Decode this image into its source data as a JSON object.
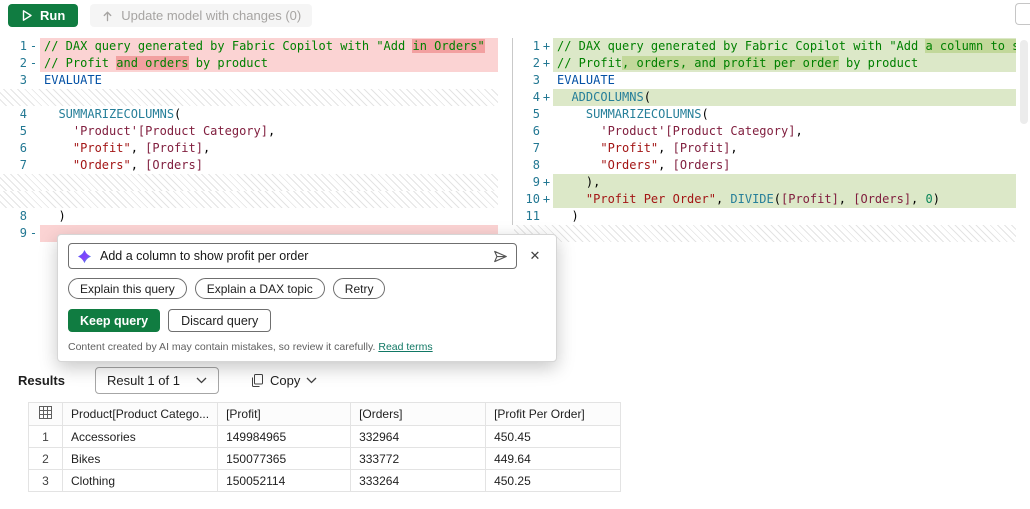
{
  "toolbar": {
    "run_label": "Run",
    "update_model_label": "Update model with changes (0)"
  },
  "editor": {
    "left": {
      "rows": [
        {
          "num": "1",
          "marker": "-",
          "kind": "del",
          "segments": [
            {
              "t": "// DAX query generated by Fabric Copilot with \"Add ",
              "c": "comment"
            },
            {
              "t": "in Orders\"",
              "c": "comment",
              "hl": true
            }
          ]
        },
        {
          "num": "2",
          "marker": "-",
          "kind": "del",
          "segments": [
            {
              "t": "// Profit ",
              "c": "comment"
            },
            {
              "t": "and orders",
              "c": "comment",
              "hl": true
            },
            {
              "t": " by product",
              "c": "comment"
            }
          ]
        },
        {
          "num": "3",
          "marker": "",
          "kind": "same",
          "segments": [
            {
              "t": "EVALUATE",
              "c": "keyword"
            }
          ]
        },
        {
          "kind": "hatch"
        },
        {
          "num": "4",
          "marker": "",
          "kind": "same",
          "segments": [
            {
              "t": "  ",
              "c": "plain"
            },
            {
              "t": "SUMMARIZECOLUMNS",
              "c": "func"
            },
            {
              "t": "(",
              "c": "plain"
            }
          ]
        },
        {
          "num": "5",
          "marker": "",
          "kind": "same",
          "segments": [
            {
              "t": "    ",
              "c": "plain"
            },
            {
              "t": "'Product'[Product Category]",
              "c": "ref"
            },
            {
              "t": ",",
              "c": "plain"
            }
          ]
        },
        {
          "num": "6",
          "marker": "",
          "kind": "same",
          "segments": [
            {
              "t": "    ",
              "c": "plain"
            },
            {
              "t": "\"Profit\"",
              "c": "string"
            },
            {
              "t": ", ",
              "c": "plain"
            },
            {
              "t": "[Profit]",
              "c": "ref"
            },
            {
              "t": ",",
              "c": "plain"
            }
          ]
        },
        {
          "num": "7",
          "marker": "",
          "kind": "same",
          "segments": [
            {
              "t": "    ",
              "c": "plain"
            },
            {
              "t": "\"Orders\"",
              "c": "string"
            },
            {
              "t": ", ",
              "c": "plain"
            },
            {
              "t": "[Orders]",
              "c": "ref"
            }
          ]
        },
        {
          "kind": "hatch"
        },
        {
          "kind": "hatch"
        },
        {
          "num": "8",
          "marker": "",
          "kind": "same",
          "segments": [
            {
              "t": "  )",
              "c": "plain"
            }
          ]
        },
        {
          "num": "9",
          "marker": "-",
          "kind": "del",
          "segments": []
        }
      ]
    },
    "right": {
      "rows": [
        {
          "num": "1",
          "marker": "+",
          "kind": "add",
          "segments": [
            {
              "t": "// DAX query generated by Fabric Copilot with \"Add ",
              "c": "comment"
            },
            {
              "t": "a column to show profit per order\"",
              "c": "comment",
              "hl": true
            }
          ]
        },
        {
          "num": "2",
          "marker": "+",
          "kind": "add",
          "segments": [
            {
              "t": "// Profit",
              "c": "comment"
            },
            {
              "t": ", orders, and profit per order",
              "c": "comment",
              "hl": true
            },
            {
              "t": " by product",
              "c": "comment"
            }
          ]
        },
        {
          "num": "3",
          "marker": "",
          "kind": "same",
          "segments": [
            {
              "t": "EVALUATE",
              "c": "keyword"
            }
          ]
        },
        {
          "num": "4",
          "marker": "+",
          "kind": "add",
          "segments": [
            {
              "t": "  ",
              "c": "plain"
            },
            {
              "t": "ADDCOLUMNS",
              "c": "func"
            },
            {
              "t": "(",
              "c": "plain"
            }
          ]
        },
        {
          "num": "5",
          "marker": "",
          "kind": "same",
          "segments": [
            {
              "t": "    ",
              "c": "plain"
            },
            {
              "t": "SUMMARIZECOLUMNS",
              "c": "func"
            },
            {
              "t": "(",
              "c": "plain"
            }
          ]
        },
        {
          "num": "6",
          "marker": "",
          "kind": "same",
          "segments": [
            {
              "t": "      ",
              "c": "plain"
            },
            {
              "t": "'Product'[Product Category]",
              "c": "ref"
            },
            {
              "t": ",",
              "c": "plain"
            }
          ]
        },
        {
          "num": "7",
          "marker": "",
          "kind": "same",
          "segments": [
            {
              "t": "      ",
              "c": "plain"
            },
            {
              "t": "\"Profit\"",
              "c": "string"
            },
            {
              "t": ", ",
              "c": "plain"
            },
            {
              "t": "[Profit]",
              "c": "ref"
            },
            {
              "t": ",",
              "c": "plain"
            }
          ]
        },
        {
          "num": "8",
          "marker": "",
          "kind": "same",
          "segments": [
            {
              "t": "      ",
              "c": "plain"
            },
            {
              "t": "\"Orders\"",
              "c": "string"
            },
            {
              "t": ", ",
              "c": "plain"
            },
            {
              "t": "[Orders]",
              "c": "ref"
            }
          ]
        },
        {
          "num": "9",
          "marker": "+",
          "kind": "add",
          "segments": [
            {
              "t": "    ),",
              "c": "plain"
            }
          ]
        },
        {
          "num": "10",
          "marker": "+",
          "kind": "add",
          "segments": [
            {
              "t": "    ",
              "c": "plain"
            },
            {
              "t": "\"Profit Per Order\"",
              "c": "string"
            },
            {
              "t": ", ",
              "c": "plain"
            },
            {
              "t": "DIVIDE",
              "c": "func"
            },
            {
              "t": "(",
              "c": "plain"
            },
            {
              "t": "[Profit]",
              "c": "ref"
            },
            {
              "t": ", ",
              "c": "plain"
            },
            {
              "t": "[Orders]",
              "c": "ref"
            },
            {
              "t": ", ",
              "c": "plain"
            },
            {
              "t": "0",
              "c": "number"
            },
            {
              "t": ")",
              "c": "plain"
            }
          ]
        },
        {
          "num": "11",
          "marker": "",
          "kind": "same",
          "segments": [
            {
              "t": "  )",
              "c": "plain"
            }
          ]
        },
        {
          "kind": "hatch"
        }
      ]
    },
    "revert_arrow": "→"
  },
  "copilot": {
    "prompt": "Add a column to show profit per order",
    "actions": [
      "Explain this query",
      "Explain a DAX topic",
      "Retry"
    ],
    "keep_label": "Keep query",
    "discard_label": "Discard query",
    "close_glyph": "✕",
    "disclaimer": "Content created by AI may contain mistakes, so review it carefully.",
    "read_terms": "Read terms"
  },
  "results": {
    "title": "Results",
    "selector": "Result 1 of 1",
    "copy_label": "Copy",
    "table": {
      "columns": [
        "Product[Product Catego...",
        "[Profit]",
        "[Orders]",
        "[Profit Per Order]"
      ],
      "rows": [
        {
          "n": "1",
          "cells": [
            "Accessories",
            "149984965",
            "332964",
            "450.45"
          ]
        },
        {
          "n": "2",
          "cells": [
            "Bikes",
            "150077365",
            "333772",
            "449.64"
          ]
        },
        {
          "n": "3",
          "cells": [
            "Clothing",
            "150052114",
            "333264",
            "450.25"
          ]
        }
      ]
    }
  },
  "colors": {
    "accent_green": "#107c41",
    "diff_delete_line": "#fbd3d3",
    "diff_delete_word": "#f2a0a0",
    "diff_add_line": "#dce8c8",
    "diff_add_word": "#c2d89a",
    "link_teal": "#117865"
  }
}
